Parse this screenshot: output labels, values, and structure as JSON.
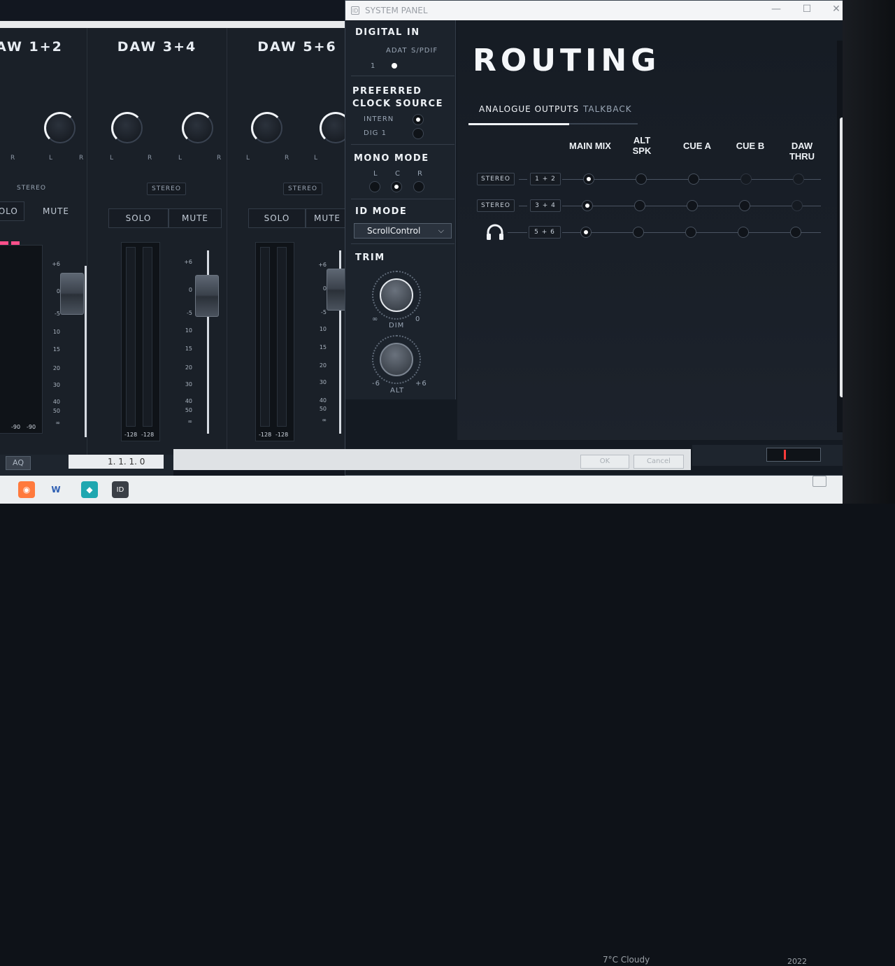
{
  "mixer": {
    "channels": [
      {
        "title": "AW 1+2",
        "stereo": "STEREO",
        "solo": "SOLO",
        "mute": "MUTE",
        "l": "L",
        "r": "R",
        "meter_l": "-90",
        "meter_r": "-90"
      },
      {
        "title": "DAW 3+4",
        "stereo": "STEREO",
        "solo": "SOLO",
        "mute": "MUTE",
        "l": "L",
        "r": "R",
        "meter_l": "-128",
        "meter_r": "-128"
      },
      {
        "title": "DAW 5+6",
        "stereo": "STEREO",
        "solo": "SOLO",
        "mute": "MUTE",
        "l": "L",
        "r": "R",
        "meter_l": "-128",
        "meter_r": "-128"
      }
    ],
    "scale": [
      "+6",
      "0",
      "-5",
      "10",
      "15",
      "20",
      "30",
      "40",
      "50",
      "∞"
    ]
  },
  "window": {
    "title": "SYSTEM PANEL",
    "minimize": "—",
    "maximize": "☐",
    "close": "✕"
  },
  "left_panel": {
    "digital_in": {
      "title": "DIGITAL IN",
      "adat": "ADAT",
      "spdif": "S/PDIF",
      "num": "1"
    },
    "clock": {
      "title_line1": "PREFERRED",
      "title_line2": "CLOCK SOURCE",
      "intern": "INTERN",
      "dig1": "DIG 1"
    },
    "mono": {
      "title": "MONO MODE",
      "l": "L",
      "c": "C",
      "r": "R"
    },
    "id_mode": {
      "title": "ID MODE",
      "value": "ScrollControl",
      "chevron": "⌵"
    },
    "trim": {
      "title": "TRIM",
      "dim_label": "DIM",
      "dim_min": "∞",
      "dim_max": "0",
      "alt_label": "ALT",
      "alt_min": "-6",
      "alt_max": "+6"
    }
  },
  "routing": {
    "title": "ROUTING",
    "tabs": [
      {
        "label": "ANALOGUE OUTPUTS",
        "active": true
      },
      {
        "label": "TALKBACK",
        "active": false
      }
    ],
    "columns": [
      "MAIN MIX",
      "ALT SPK",
      "CUE A",
      "CUE B",
      "DAW THRU"
    ],
    "rows": [
      {
        "type": "STEREO",
        "source": "1 + 2",
        "on": [
          true,
          false,
          false,
          false,
          false
        ]
      },
      {
        "type": "STEREO",
        "source": "3 + 4",
        "on": [
          true,
          false,
          false,
          false,
          false
        ]
      },
      {
        "type": "headphones-icon",
        "source": "5 + 6",
        "on": [
          true,
          false,
          false,
          false,
          false
        ]
      }
    ]
  },
  "footer": {
    "ok": "OK",
    "cancel": "Cancel",
    "position": "1. 1. 1.  0",
    "aq": "AQ"
  },
  "taskbar": {
    "weather": "7°C  Cloudy",
    "year": "2022"
  },
  "side": {
    "page": "1"
  },
  "colors": {
    "accent": "#f1f4f8",
    "mute_pink": "#ff4f8a",
    "panel": "#141a22"
  }
}
